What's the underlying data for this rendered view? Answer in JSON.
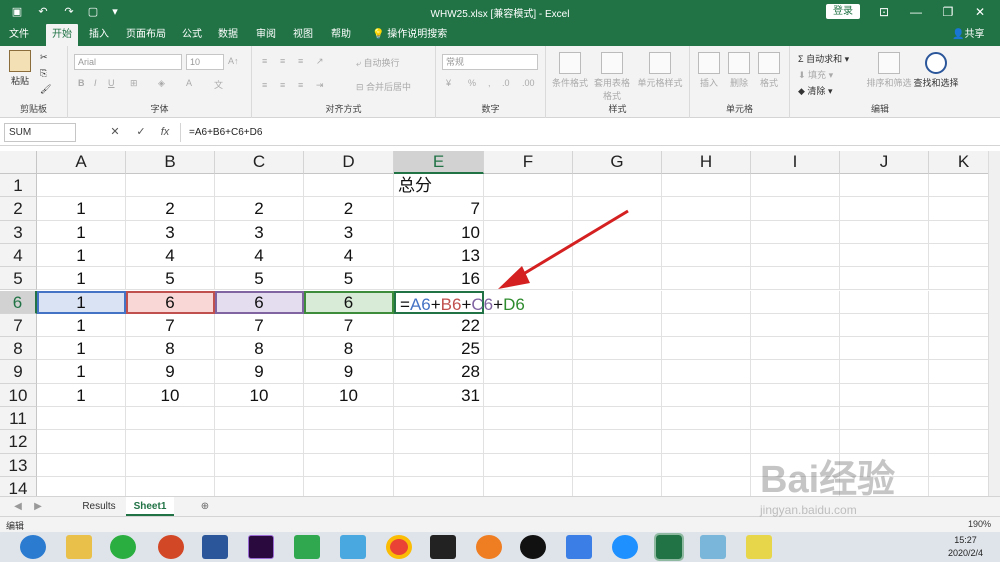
{
  "window": {
    "title": "WHW25.xlsx [兼容模式] - Excel",
    "login_label": "登录"
  },
  "colors": {
    "accent": "#217346",
    "ref_a": "#4472c4",
    "ref_b": "#c0504d",
    "ref_c": "#8064a2",
    "ref_d": "#2e8b2e",
    "arrow": "#d42020"
  },
  "tabs": [
    "文件",
    "开始",
    "插入",
    "页面布局",
    "公式",
    "数据",
    "审阅",
    "视图",
    "帮助"
  ],
  "search_label": "操作说明搜索",
  "share_label": "共享",
  "ribbon": {
    "clipboard": {
      "paste": "粘贴",
      "label": "剪贴板"
    },
    "font": {
      "name": "Arial",
      "size": "10",
      "label": "字体"
    },
    "alignment": {
      "wrap": "自动换行",
      "merge": "合并后居中",
      "label": "对齐方式"
    },
    "number": {
      "format": "常规",
      "label": "数字"
    },
    "styles": {
      "conditional": "条件格式",
      "table": "套用表格格式",
      "cell_styles": "单元格样式",
      "label": "样式"
    },
    "cells": {
      "insert": "插入",
      "delete": "删除",
      "format": "格式",
      "label": "单元格"
    },
    "editing": {
      "autosum": "自动求和",
      "fill": "填充",
      "clear": "清除",
      "sort": "排序和筛选",
      "find": "查找和选择",
      "label": "编辑"
    }
  },
  "formula_bar": {
    "name_box": "SUM",
    "cancel": "✕",
    "enter": "✓",
    "fx": "fx",
    "formula": "=A6+B6+C6+D6"
  },
  "columns": [
    "A",
    "B",
    "C",
    "D",
    "E",
    "F",
    "G",
    "H",
    "I",
    "J",
    "K"
  ],
  "rows": [
    "1",
    "2",
    "3",
    "4",
    "5",
    "6",
    "7",
    "8",
    "9",
    "10",
    "11",
    "12",
    "13",
    "14"
  ],
  "cells": {
    "e1": "总分",
    "data": [
      [
        "1",
        "2",
        "2",
        "2",
        "7"
      ],
      [
        "1",
        "3",
        "3",
        "3",
        "10"
      ],
      [
        "1",
        "4",
        "4",
        "4",
        "13"
      ],
      [
        "1",
        "5",
        "5",
        "5",
        "16"
      ],
      [
        "1",
        "6",
        "6",
        "6",
        ""
      ],
      [
        "1",
        "7",
        "7",
        "7",
        "22"
      ],
      [
        "1",
        "8",
        "8",
        "8",
        "25"
      ],
      [
        "1",
        "9",
        "9",
        "9",
        "28"
      ],
      [
        "1",
        "10",
        "10",
        "10",
        "31"
      ]
    ],
    "edit_formula": {
      "eq": "=",
      "a": "A6",
      "p1": "+",
      "b": "B6",
      "p2": "+",
      "c": "C6",
      "p3": "+",
      "d": "D6"
    }
  },
  "sheets": [
    "Results",
    "Sheet1"
  ],
  "active_sheet": "Sheet1",
  "status": {
    "mode": "编辑",
    "zoom": "190%"
  },
  "clock": {
    "time": "15:27",
    "date": "2020/2/4"
  },
  "watermark": {
    "text": "Bai经验",
    "url": "jingyan.baidu.com"
  }
}
